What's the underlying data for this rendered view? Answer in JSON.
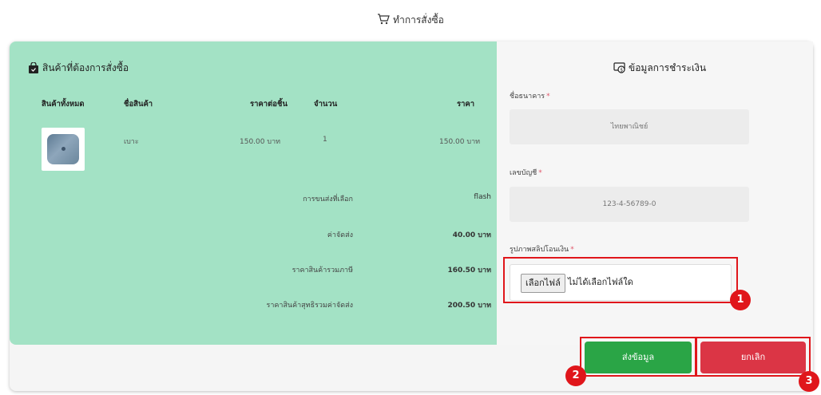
{
  "page": {
    "title": "ทำการสั่งซื้อ"
  },
  "order": {
    "heading": "สินค้าที่ต้องการสั่งซื้อ",
    "columns": {
      "all_items": "สินค้าทั้งหมด",
      "name": "ชื่อสินค้า",
      "unit_price": "ราคาต่อชิ้น",
      "qty": "จำนวน",
      "price": "ราคา"
    },
    "items": [
      {
        "name": "เบาะ",
        "unit_price": "150.00 บาท",
        "qty": "1",
        "price": "150.00 บาท"
      }
    ],
    "summary": [
      {
        "label": "การขนส่งที่เลือก",
        "value": "flash"
      },
      {
        "label": "ค่าจัดส่ง",
        "value": "40.00 บาท"
      },
      {
        "label": "ราคาสินค้ารวมภาษี",
        "value": "160.50 บาท"
      },
      {
        "label": "ราคาสินค้าสุทธิรวมค่าจัดส่ง",
        "value": "200.50 บาท"
      }
    ]
  },
  "payment": {
    "heading": "ข้อมูลการชำระเงิน",
    "bank_label": "ชื่อธนาคาร",
    "bank_value": "ไทยพาณิชย์",
    "account_label": "เลขบัญชี",
    "account_value": "123-4-56789-0",
    "slip_label": "รูปภาพสลิปโอนเงิน",
    "required_mark": "*",
    "file_button": "เลือกไฟล์",
    "file_status": "ไม่ได้เลือกไฟล์ใด"
  },
  "actions": {
    "submit": "ส่งข้อมูล",
    "cancel": "ยกเลิก"
  },
  "annotations": [
    "1",
    "2",
    "3"
  ],
  "colors": {
    "panel_green": "#a3e2c5",
    "submit": "#2aa546",
    "cancel": "#db3545",
    "highlight": "#e0161b"
  }
}
